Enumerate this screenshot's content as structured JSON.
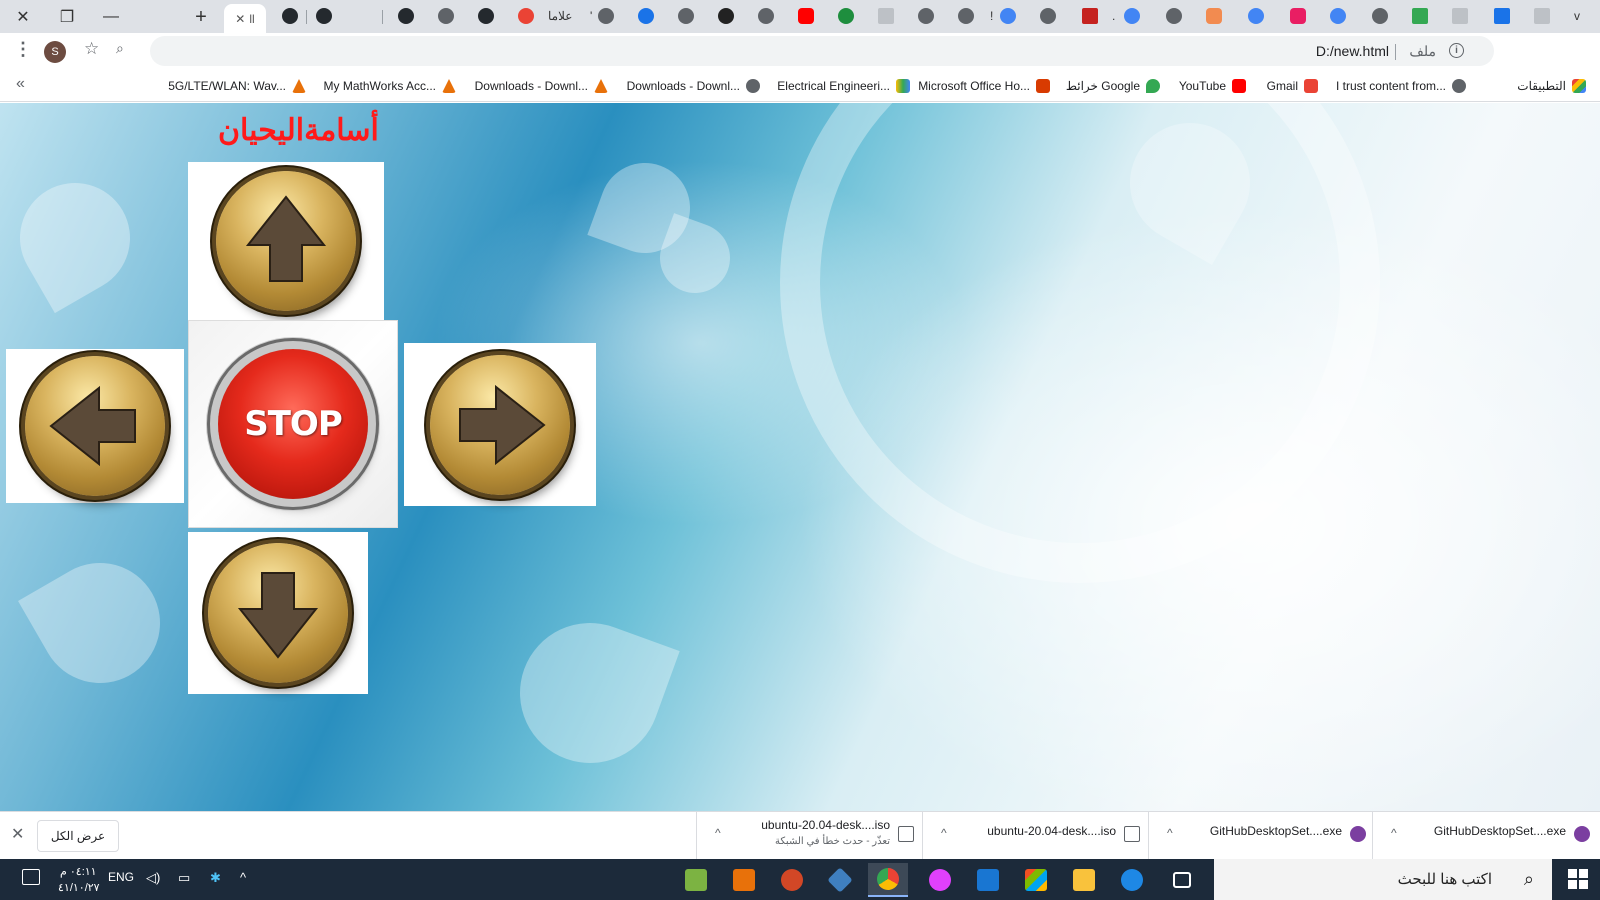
{
  "window": {
    "close_glyph": "✕",
    "restore_glyph": "❐",
    "minimize_glyph": "—",
    "newtab_glyph": "+"
  },
  "tabs": {
    "active_close": "✕",
    "active_label": "ll",
    "text_tabs": [
      "علاما",
      "'",
      "!",
      ".",
      "v"
    ]
  },
  "toolbar": {
    "url": "D:/new.html",
    "scheme_label": "ملف",
    "info_glyph": "i",
    "reload_glyph": "↻",
    "back_glyph": "←",
    "forward_glyph": "→",
    "star_glyph": "☆",
    "zoom_glyph": "⌕",
    "avatar_letter": "S",
    "menu_glyph": "⋮"
  },
  "bookmarks": {
    "chevron": "«",
    "items": [
      {
        "label": "التطبيقات",
        "color": "#ea4335"
      },
      {
        "label": "I trust content from...",
        "color": "#5f6368"
      },
      {
        "label": "Gmail",
        "color": "#ea4335"
      },
      {
        "label": "YouTube",
        "color": "#ff0000"
      },
      {
        "label": "خرائط Google",
        "color": "#34a853"
      },
      {
        "label": "Microsoft Office Ho...",
        "color": "#d83b01"
      },
      {
        "label": "Electrical Engineeri...",
        "color": "#4285f4"
      },
      {
        "label": "Downloads - Downl...",
        "color": "#5f6368"
      },
      {
        "label": "Downloads - Downl...",
        "color": "#e8710a"
      },
      {
        "label": "My MathWorks Acc...",
        "color": "#e8710a"
      },
      {
        "label": "5G/LTE/WLAN: Wav...",
        "color": "#e8710a"
      }
    ]
  },
  "page": {
    "title": "أسامةاليحيان",
    "stop_label": "STOP"
  },
  "downloads": {
    "close_glyph": "✕",
    "show_all": "عرض الكل",
    "items": [
      {
        "name": "GitHubDesktopSet....exe",
        "status": ""
      },
      {
        "name": "GitHubDesktopSet....exe",
        "status": ""
      },
      {
        "name": "ubuntu-20.04-desk....iso",
        "status": ""
      },
      {
        "name": "ubuntu-20.04-desk....iso",
        "status": "تعذّر - حدث خطأ في الشبكة"
      }
    ],
    "chevron": "^"
  },
  "taskbar": {
    "search_placeholder": "اكتب هنا للبحث",
    "search_glyph": "⌕",
    "tray": {
      "lang": "ENG",
      "chevron": "^",
      "time": "٠٤:١١ م",
      "date": "٤١/١٠/٢٧"
    }
  },
  "colors": {
    "title_red": "#ff1a1a",
    "chrome_tabstrip": "#dee1e6",
    "taskbar": "#1c2a3a"
  }
}
